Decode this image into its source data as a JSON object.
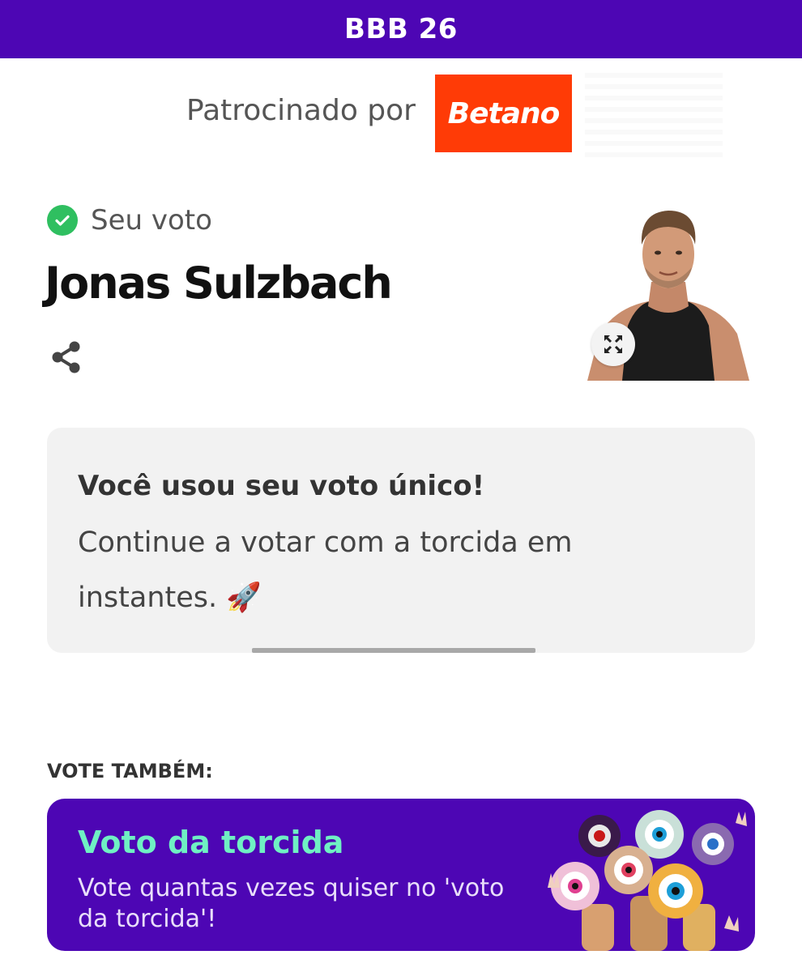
{
  "header": {
    "title": "BBB 26"
  },
  "sponsor": {
    "label": "Patrocinado por",
    "logo_text": "Betano",
    "logo_color": "#ff3b06"
  },
  "vote": {
    "status_label": "Seu voto",
    "status_icon": "check-circle-icon",
    "candidate_name": "Jonas Sulzbach",
    "share_icon": "share-icon",
    "expand_icon": "expand-icon"
  },
  "message": {
    "heading": "Você usou seu voto único!",
    "body": "Continue a votar com a torcida em instantes. 🚀"
  },
  "also_vote": {
    "label": "VOTE TAMBÉM:",
    "card": {
      "title": "Voto da torcida",
      "description": "Vote quantas vezes quiser no 'voto da torcida'!"
    }
  },
  "colors": {
    "brand_purple": "#4d06b4",
    "accent_green": "#6ff0c3",
    "check_green": "#2fbf60"
  }
}
